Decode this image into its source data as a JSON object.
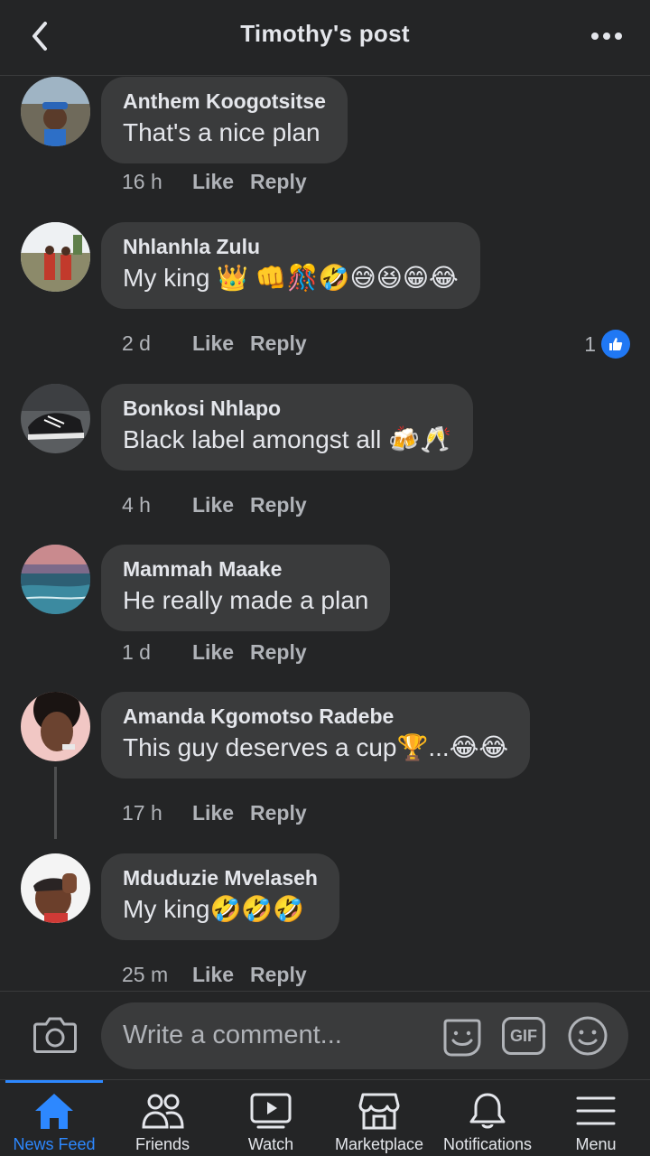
{
  "header": {
    "title": "Timothy's post"
  },
  "comments": [
    {
      "name": "Anthem Koogotsitse",
      "text": "That's a nice plan",
      "time": "16 h",
      "like": "Like",
      "reply": "Reply"
    },
    {
      "name": "Nhlanhla Zulu",
      "text": "My king 👑 👊🎊🤣😅😆😁😂",
      "time": "2 d",
      "like": "Like",
      "reply": "Reply",
      "reaction_count": "1"
    },
    {
      "name": "Bonkosi Nhlapo",
      "text": "Black label amongst all 🍻🥂",
      "time": "4 h",
      "like": "Like",
      "reply": "Reply"
    },
    {
      "name": "Mammah Maake",
      "text": "He really made a plan",
      "time": "1 d",
      "like": "Like",
      "reply": "Reply"
    },
    {
      "name": "Amanda Kgomotso Radebe",
      "text": "This guy deserves a cup🏆...😂😂",
      "time": "17 h",
      "like": "Like",
      "reply": "Reply"
    },
    {
      "name": "Mduduzie Mvelaseh",
      "text": "My king🤣🤣🤣",
      "time": "25 m",
      "like": "Like",
      "reply": "Reply"
    }
  ],
  "composer": {
    "placeholder": "Write a comment...",
    "gif_label": "GIF"
  },
  "tabs": [
    {
      "label": "News Feed",
      "icon": "home-icon",
      "active": true
    },
    {
      "label": "Friends",
      "icon": "friends-icon"
    },
    {
      "label": "Watch",
      "icon": "watch-icon"
    },
    {
      "label": "Marketplace",
      "icon": "marketplace-icon"
    },
    {
      "label": "Notifications",
      "icon": "bell-icon"
    },
    {
      "label": "Menu",
      "icon": "menu-icon"
    }
  ],
  "colors": {
    "background": "#242526",
    "bubble": "#3a3b3c",
    "accent": "#2d88ff",
    "muted": "#b0b3b8"
  }
}
